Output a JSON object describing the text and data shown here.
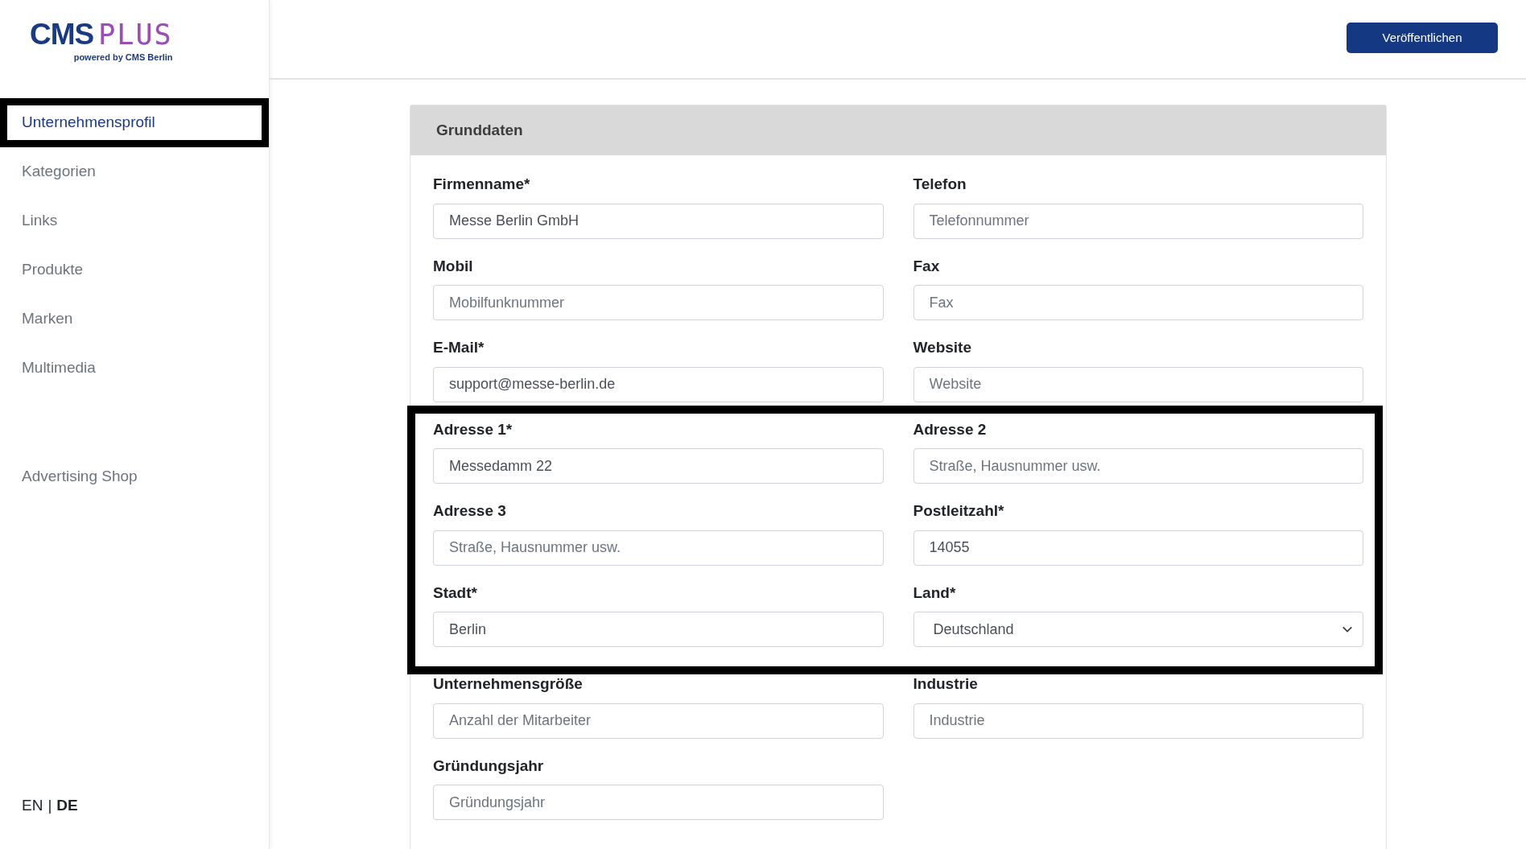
{
  "logo": {
    "main": "CMS",
    "accent": "PLUS",
    "tagline": "powered by CMS Berlin"
  },
  "sidebar": {
    "items": [
      {
        "label": "Unternehmensprofil",
        "selected": true,
        "highlighted": true
      },
      {
        "label": "Kategorien",
        "selected": false,
        "highlighted": false
      },
      {
        "label": "Links",
        "selected": false,
        "highlighted": false
      },
      {
        "label": "Produkte",
        "selected": false,
        "highlighted": false
      },
      {
        "label": "Marken",
        "selected": false,
        "highlighted": false
      },
      {
        "label": "Multimedia",
        "selected": false,
        "highlighted": false
      }
    ],
    "shop_link": "Advertising Shop",
    "languages": [
      {
        "label": "EN",
        "selected": false
      },
      {
        "label": "DE",
        "selected": true
      }
    ],
    "language_separator": "|"
  },
  "header": {
    "publish_button": "Veröffentlichen"
  },
  "card": {
    "title": "Grunddaten",
    "groups": [
      {
        "highlighted": false,
        "fields": [
          {
            "kind": "input",
            "label": "Firmenname*",
            "value": "Messe Berlin GmbH"
          },
          {
            "kind": "input",
            "label": "Telefon",
            "placeholder": "Telefonnummer"
          },
          {
            "kind": "input",
            "label": "Mobil",
            "placeholder": "Mobilfunknummer"
          },
          {
            "kind": "input",
            "label": "Fax",
            "placeholder": "Fax"
          },
          {
            "kind": "input",
            "label": "E-Mail*",
            "value": "support@messe-berlin.de"
          },
          {
            "kind": "input",
            "label": "Website",
            "placeholder": "Website"
          }
        ]
      },
      {
        "highlighted": true,
        "fields": [
          {
            "kind": "input",
            "label": "Adresse 1*",
            "value": "Messedamm 22"
          },
          {
            "kind": "input",
            "label": "Adresse 2",
            "placeholder": "Straße, Hausnummer usw."
          },
          {
            "kind": "input",
            "label": "Adresse 3",
            "placeholder": "Straße, Hausnummer usw."
          },
          {
            "kind": "input",
            "label": "Postleitzahl*",
            "value": "14055"
          },
          {
            "kind": "input",
            "label": "Stadt*",
            "value": "Berlin"
          },
          {
            "kind": "select",
            "label": "Land*",
            "value": "Deutschland"
          }
        ]
      },
      {
        "highlighted": false,
        "fields": [
          {
            "kind": "input",
            "label": "Unternehmensgröße",
            "placeholder": "Anzahl der Mitarbeiter"
          },
          {
            "kind": "input",
            "label": "Industrie",
            "placeholder": "Industrie"
          },
          {
            "kind": "input",
            "label": "Gründungsjahr",
            "placeholder": "Gründungsjahr"
          }
        ]
      }
    ]
  }
}
